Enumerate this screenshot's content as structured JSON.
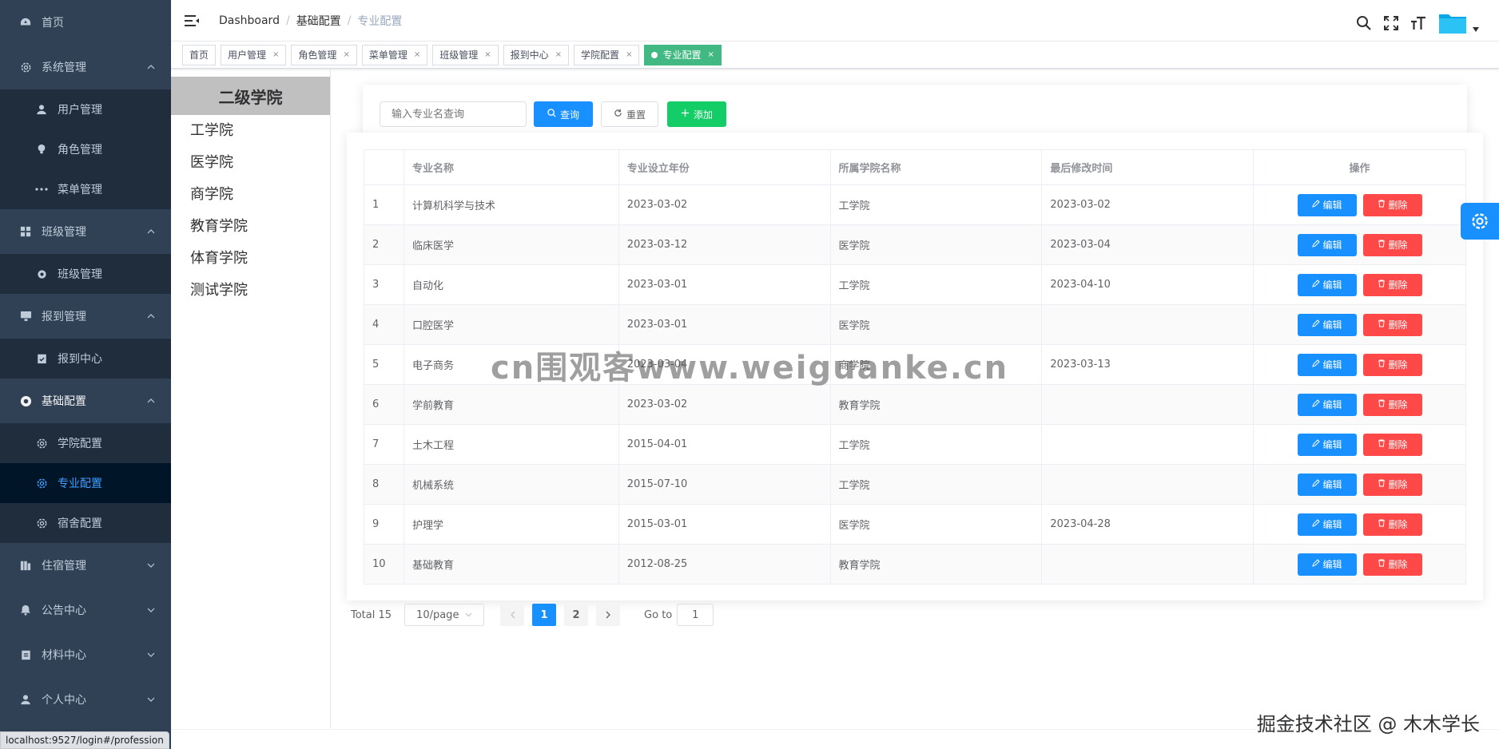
{
  "sidebar": {
    "items": [
      {
        "label": "首页",
        "icon": "dashboard-icon"
      },
      {
        "label": "系统管理",
        "icon": "gear-icon",
        "children": [
          {
            "label": "用户管理",
            "icon": "user-icon"
          },
          {
            "label": "角色管理",
            "icon": "bulb-icon"
          },
          {
            "label": "菜单管理",
            "icon": "more-icon"
          }
        ]
      },
      {
        "label": "班级管理",
        "icon": "grid-icon",
        "children": [
          {
            "label": "班级管理",
            "icon": "gear-icon"
          }
        ]
      },
      {
        "label": "报到管理",
        "icon": "monitor-icon",
        "children": [
          {
            "label": "报到中心",
            "icon": "checklist-icon"
          }
        ]
      },
      {
        "label": "基础配置",
        "icon": "circle-plus-icon",
        "children": [
          {
            "label": "学院配置",
            "icon": "gear-icon"
          },
          {
            "label": "专业配置",
            "icon": "gear-icon"
          },
          {
            "label": "宿舍配置",
            "icon": "gear-icon"
          }
        ]
      },
      {
        "label": "住宿管理",
        "icon": "building-icon"
      },
      {
        "label": "公告中心",
        "icon": "bell-icon"
      },
      {
        "label": "材料中心",
        "icon": "clipboard-icon"
      },
      {
        "label": "个人中心",
        "icon": "user-icon"
      }
    ]
  },
  "statusbar": {
    "url": "localhost:9527/login#/profession"
  },
  "header": {
    "breadcrumb": [
      "Dashboard",
      "基础配置",
      "专业配置"
    ]
  },
  "tags": [
    {
      "label": "首页"
    },
    {
      "label": "用户管理"
    },
    {
      "label": "角色管理"
    },
    {
      "label": "菜单管理"
    },
    {
      "label": "班级管理"
    },
    {
      "label": "报到中心"
    },
    {
      "label": "学院配置"
    },
    {
      "label": "专业配置"
    }
  ],
  "college_panel": {
    "title": "二级学院",
    "items": [
      "工学院",
      "医学院",
      "商学院",
      "教育学院",
      "体育学院",
      "测试学院"
    ]
  },
  "search": {
    "placeholder": "输入专业名查询",
    "query_label": "查询",
    "reset_label": "重置",
    "add_label": "添加"
  },
  "table": {
    "columns": [
      "",
      "专业名称",
      "专业设立年份",
      "所属学院名称",
      "最后修改时间",
      "操作"
    ],
    "edit_label": "编辑",
    "delete_label": "删除",
    "rows": [
      [
        "1",
        "计算机科学与技术",
        "2023-03-02",
        "工学院",
        "2023-03-02"
      ],
      [
        "2",
        "临床医学",
        "2023-03-12",
        "医学院",
        "2023-03-04"
      ],
      [
        "3",
        "自动化",
        "2023-03-01",
        "工学院",
        "2023-04-10"
      ],
      [
        "4",
        "口腔医学",
        "2023-03-01",
        "医学院",
        ""
      ],
      [
        "5",
        "电子商务",
        "2023-03-04",
        "商学院",
        "2023-03-13"
      ],
      [
        "6",
        "学前教育",
        "2023-03-02",
        "教育学院",
        ""
      ],
      [
        "7",
        "土木工程",
        "2015-04-01",
        "工学院",
        ""
      ],
      [
        "8",
        "机械系统",
        "2015-07-10",
        "工学院",
        ""
      ],
      [
        "9",
        "护理学",
        "2015-03-01",
        "医学院",
        "2023-04-28"
      ],
      [
        "10",
        "基础教育",
        "2012-08-25",
        "教育学院",
        ""
      ]
    ]
  },
  "pager": {
    "total": "Total 15",
    "page_size": "10/page",
    "pages": [
      "1",
      "2"
    ],
    "current": "1",
    "goto_label": "Go to",
    "goto_value": "1"
  },
  "watermark": "cn围观客www.weiguanke.cn",
  "credit": "掘金技术社区 @ 木木学长",
  "colors": {
    "sidebar_bg": "#304156",
    "submenu_bg": "#1f2d3d",
    "primary": "#1890ff",
    "success": "#13ce66",
    "danger": "#ff4949",
    "tag_active": "#42b983"
  }
}
